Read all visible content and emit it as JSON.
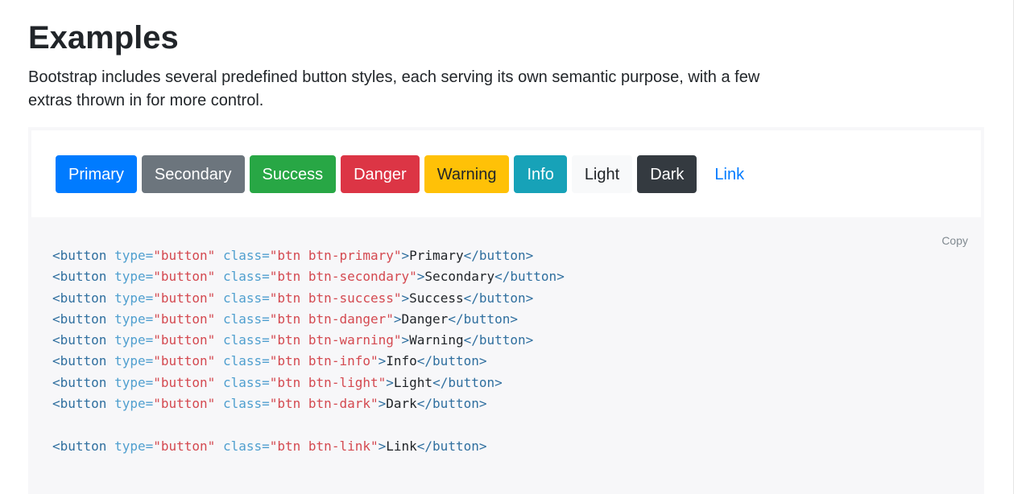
{
  "header": {
    "title": "Examples",
    "lead": "Bootstrap includes several predefined button styles, each serving its own semantic purpose, with a few extras thrown in for more control."
  },
  "buttons": [
    {
      "label": "Primary",
      "bg": "#007bff",
      "fg": "#ffffff",
      "border": "#007bff"
    },
    {
      "label": "Secondary",
      "bg": "#6c757d",
      "fg": "#ffffff",
      "border": "#6c757d"
    },
    {
      "label": "Success",
      "bg": "#28a745",
      "fg": "#ffffff",
      "border": "#28a745"
    },
    {
      "label": "Danger",
      "bg": "#dc3545",
      "fg": "#ffffff",
      "border": "#dc3545"
    },
    {
      "label": "Warning",
      "bg": "#ffc107",
      "fg": "#212529",
      "border": "#ffc107"
    },
    {
      "label": "Info",
      "bg": "#17a2b8",
      "fg": "#ffffff",
      "border": "#17a2b8"
    },
    {
      "label": "Light",
      "bg": "#f8f9fa",
      "fg": "#212529",
      "border": "#f8f9fa"
    },
    {
      "label": "Dark",
      "bg": "#343a40",
      "fg": "#ffffff",
      "border": "#343a40"
    },
    {
      "label": "Link",
      "bg": "transparent",
      "fg": "#007bff",
      "border": "transparent"
    }
  ],
  "code_block": {
    "copy_label": "Copy",
    "lines": [
      {
        "tag_open": "<button",
        "attr1": "type=",
        "val1": "\"button\"",
        "attr2": "class=",
        "val2": "\"btn btn-primary\"",
        "close_bracket": ">",
        "text": "Primary",
        "tag_close": "</button>"
      },
      {
        "tag_open": "<button",
        "attr1": "type=",
        "val1": "\"button\"",
        "attr2": "class=",
        "val2": "\"btn btn-secondary\"",
        "close_bracket": ">",
        "text": "Secondary",
        "tag_close": "</button>"
      },
      {
        "tag_open": "<button",
        "attr1": "type=",
        "val1": "\"button\"",
        "attr2": "class=",
        "val2": "\"btn btn-success\"",
        "close_bracket": ">",
        "text": "Success",
        "tag_close": "</button>"
      },
      {
        "tag_open": "<button",
        "attr1": "type=",
        "val1": "\"button\"",
        "attr2": "class=",
        "val2": "\"btn btn-danger\"",
        "close_bracket": ">",
        "text": "Danger",
        "tag_close": "</button>"
      },
      {
        "tag_open": "<button",
        "attr1": "type=",
        "val1": "\"button\"",
        "attr2": "class=",
        "val2": "\"btn btn-warning\"",
        "close_bracket": ">",
        "text": "Warning",
        "tag_close": "</button>"
      },
      {
        "tag_open": "<button",
        "attr1": "type=",
        "val1": "\"button\"",
        "attr2": "class=",
        "val2": "\"btn btn-info\"",
        "close_bracket": ">",
        "text": "Info",
        "tag_close": "</button>"
      },
      {
        "tag_open": "<button",
        "attr1": "type=",
        "val1": "\"button\"",
        "attr2": "class=",
        "val2": "\"btn btn-light\"",
        "close_bracket": ">",
        "text": "Light",
        "tag_close": "</button>"
      },
      {
        "tag_open": "<button",
        "attr1": "type=",
        "val1": "\"button\"",
        "attr2": "class=",
        "val2": "\"btn btn-dark\"",
        "close_bracket": ">",
        "text": "Dark",
        "tag_close": "</button>"
      },
      null,
      {
        "tag_open": "<button",
        "attr1": "type=",
        "val1": "\"button\"",
        "attr2": "class=",
        "val2": "\"btn btn-link\"",
        "close_bracket": ">",
        "text": "Link",
        "tag_close": "</button>"
      }
    ]
  }
}
